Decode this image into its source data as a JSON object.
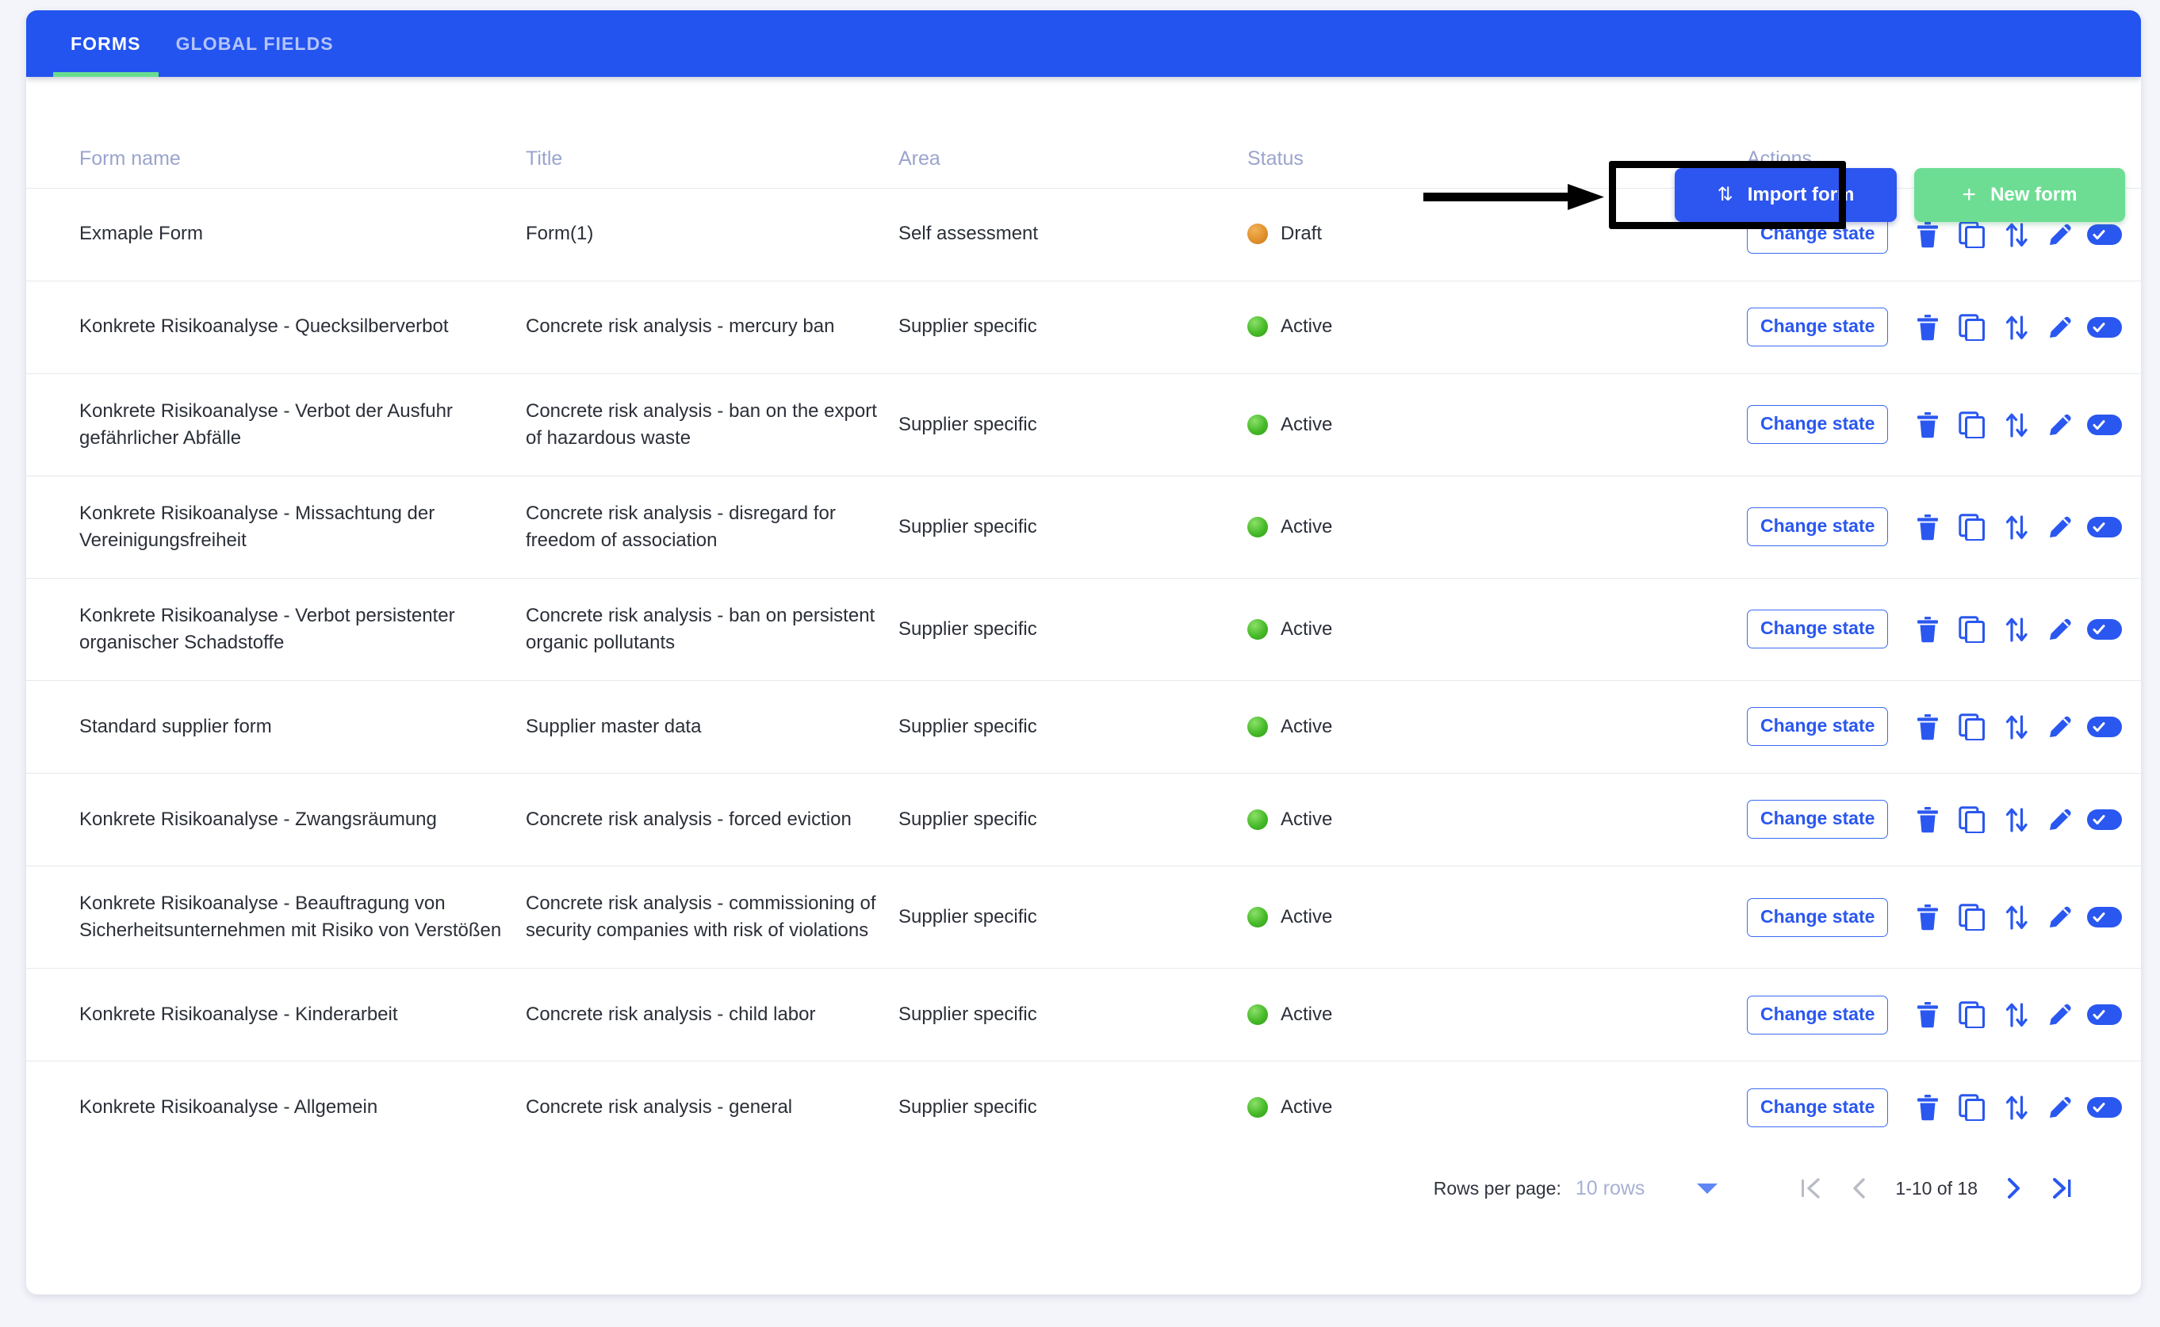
{
  "tabs": [
    {
      "label": "FORMS",
      "active": true
    },
    {
      "label": "GLOBAL FIELDS",
      "active": false
    }
  ],
  "toolbar": {
    "import_label": "Import form",
    "import_icon": "import-arrows-icon",
    "new_label": "New form",
    "new_icon": "plus-icon",
    "import_accent": "#2d55ef",
    "new_accent": "#6ddd93",
    "highlight_color": "#000000"
  },
  "table": {
    "headers": [
      "Form name",
      "Title",
      "Area",
      "Status",
      "Actions"
    ],
    "action_label": "Change state",
    "row_icons": [
      "delete-icon",
      "duplicate-icon",
      "export-icon",
      "edit-icon",
      "toggle-on-icon"
    ],
    "rows": [
      {
        "name": "Exmaple Form",
        "title": "Form(1)",
        "area": "Self assessment",
        "status": "Draft",
        "status_kind": "draft"
      },
      {
        "name": "Konkrete Risikoanalyse - Quecksilberverbot",
        "title": "Concrete risk analysis - mercury ban",
        "area": "Supplier specific",
        "status": "Active",
        "status_kind": "active"
      },
      {
        "name": "Konkrete Risikoanalyse - Verbot der Ausfuhr gefährlicher Abfälle",
        "title": "Concrete risk analysis - ban on the export of hazardous waste",
        "area": "Supplier specific",
        "status": "Active",
        "status_kind": "active"
      },
      {
        "name": "Konkrete Risikoanalyse - Missachtung der Vereinigungsfreiheit",
        "title": "Concrete risk analysis - disregard for freedom of association",
        "area": "Supplier specific",
        "status": "Active",
        "status_kind": "active"
      },
      {
        "name": "Konkrete Risikoanalyse - Verbot persistenter organischer Schadstoffe",
        "title": "Concrete risk analysis - ban on persistent organic pollutants",
        "area": "Supplier specific",
        "status": "Active",
        "status_kind": "active"
      },
      {
        "name": "Standard supplier form",
        "title": "Supplier master data",
        "area": "Supplier specific",
        "status": "Active",
        "status_kind": "active"
      },
      {
        "name": "Konkrete Risikoanalyse - Zwangsräumung",
        "title": "Concrete risk analysis - forced eviction",
        "area": "Supplier specific",
        "status": "Active",
        "status_kind": "active"
      },
      {
        "name": "Konkrete Risikoanalyse - Beauftragung von Sicherheitsunternehmen mit Risiko von Verstößen",
        "title": "Concrete risk analysis - commissioning of security companies with risk of violations",
        "area": "Supplier specific",
        "status": "Active",
        "status_kind": "active"
      },
      {
        "name": "Konkrete Risikoanalyse - Kinderarbeit",
        "title": "Concrete risk analysis - child labor",
        "area": "Supplier specific",
        "status": "Active",
        "status_kind": "active"
      },
      {
        "name": "Konkrete Risikoanalyse - Allgemein",
        "title": "Concrete risk analysis - general",
        "area": "Supplier specific",
        "status": "Active",
        "status_kind": "active"
      }
    ]
  },
  "pagination": {
    "rows_per_page_label": "Rows per page:",
    "rows_per_page_value": "10 rows",
    "range": "1-10 of 18",
    "first_icon": "|<",
    "prev_icon": "‹",
    "next_icon": "›",
    "last_icon": ">|"
  }
}
